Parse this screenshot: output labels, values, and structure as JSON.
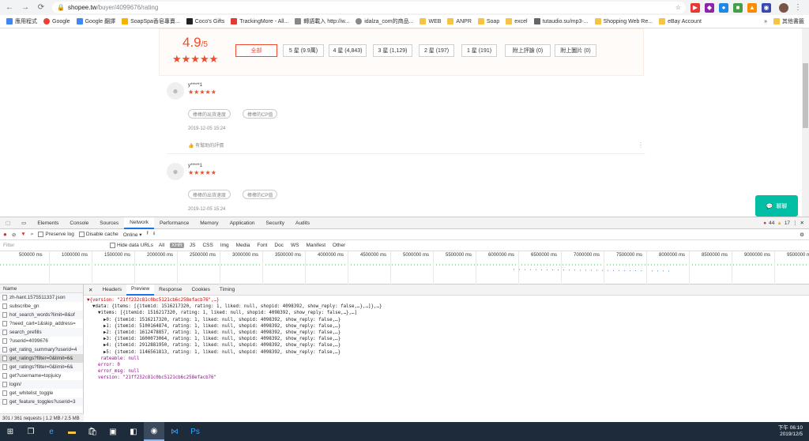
{
  "browser": {
    "url_host": "shopee.tw",
    "url_path": "/buyer/4099676/rating",
    "bookmarks": [
      "應用程式",
      "Google",
      "Google 翻譯",
      "SoapSpa香皂專賣...",
      "Coco's Gifts",
      "TrackingMore - All...",
      "轉語載入 http://w...",
      "idalza_com的商品...",
      "WEB",
      "ANPR",
      "Soap",
      "excel",
      "tutaudio.su/mp3-...",
      "Shopping Web Re...",
      "eBay Account"
    ],
    "other_bookmarks": "其他書籤",
    "bookmark_more": "»"
  },
  "page": {
    "score": "4.9",
    "score_suffix": "/5",
    "stars": "★★★★★",
    "filters": [
      "全部",
      "5 星 (9.9萬)",
      "4 星 (4,843)",
      "3 星 (1,129)",
      "2 星 (197)",
      "1 星 (191)",
      "附上評論 (0)",
      "附上圖片 (0)"
    ],
    "reviews": [
      {
        "user": "y*****1",
        "stars": "★★★★★",
        "tags": [
          "棒棒的出貨速度",
          "棒棒的CP值"
        ],
        "date": "2019-12-05 15:24",
        "helpful": "有幫助的評價"
      },
      {
        "user": "y*****1",
        "stars": "★★★★★",
        "tags": [
          "棒棒的出貨速度",
          "棒棒的CP值"
        ],
        "date": "2019-12-05 15:24",
        "helpful": ""
      }
    ],
    "chat_label": "聊聊"
  },
  "devtools": {
    "tabs": [
      "Elements",
      "Console",
      "Sources",
      "Network",
      "Performance",
      "Memory",
      "Application",
      "Security",
      "Audits"
    ],
    "active_tab": "Network",
    "errors": "44",
    "warnings": "17",
    "toolbar": {
      "preserve_log": "Preserve log",
      "disable_cache": "Disable cache",
      "throttle": "Online"
    },
    "filter_placeholder": "Filter",
    "hide_data_urls": "Hide data URLs",
    "types": [
      "All",
      "XHR",
      "JS",
      "CSS",
      "Img",
      "Media",
      "Font",
      "Doc",
      "WS",
      "Manifest",
      "Other"
    ],
    "active_type": "XHR",
    "timeline_ticks": [
      "500000 ms",
      "1000000 ms",
      "1500000 ms",
      "2000000 ms",
      "2500000 ms",
      "3000000 ms",
      "3500000 ms",
      "4000000 ms",
      "4500000 ms",
      "5000000 ms",
      "5500000 ms",
      "6000000 ms",
      "6500000 ms",
      "7000000 ms",
      "7500000 ms",
      "8000000 ms",
      "8500000 ms",
      "9000000 ms",
      "9500000 ms"
    ],
    "name_header": "Name",
    "requests": [
      "zh-hant.1575511337.json",
      "subscribe_gn",
      "hot_search_words?limit=8&of",
      "?need_cart=1&skip_address=",
      "search_prefills",
      "?userid=4099676",
      "get_rating_summary?userid=4",
      "get_ratings?filter=0&limit=6&",
      "get_ratings?filter=0&limit=6&",
      "get?username=topjuicy",
      "login/",
      "get_whitelist_toggle",
      "get_feature_toggles?userid=3"
    ],
    "selected_request": 7,
    "status_bar": "301 / 361 requests",
    "status_size": "1.2 MB / 2.5 MB",
    "preview_tabs": [
      "Headers",
      "Preview",
      "Response",
      "Cookies",
      "Timing"
    ],
    "active_preview_tab": "Preview",
    "preview_lines": [
      "▼{version: \"21ff232c81c0bc5121cb6c258efacb76\",…}",
      "  ▼data: {items: [{itemid: 1516217320, rating: 1, liked: null, shopid: 4098392, show_reply: false,…},…]},…}",
      "    ▼items: [{itemid: 1516217320, rating: 1, liked: null, shopid: 4098392, show_reply: false,…},…]",
      "      ▶0: {itemid: 1516217320, rating: 1, liked: null, shopid: 4098392, show_reply: false,…}",
      "      ▶1: {itemid: 5100164874, rating: 1, liked: null, shopid: 4098392, show_reply: false,…}",
      "      ▶2: {itemid: 1612478857, rating: 1, liked: null, shopid: 4098392, show_reply: false,…}",
      "      ▶3: {itemid: 1600073064, rating: 1, liked: null, shopid: 4098392, show_reply: false,…}",
      "      ▶4: {itemid: 2912881950, rating: 1, liked: null, shopid: 4098392, show_reply: false,…}",
      "      ▶5: {itemid: 1146561813, rating: 1, liked: null, shopid: 4098392, show_reply: false,…}",
      "     rateable: null",
      "    error: 0",
      "    error_msg: null",
      "    version: \"21ff232c81c0bc5121cb6c258efacb76\""
    ]
  },
  "taskbar": {
    "time": "下午 06:10",
    "date": "2019/12/5"
  }
}
